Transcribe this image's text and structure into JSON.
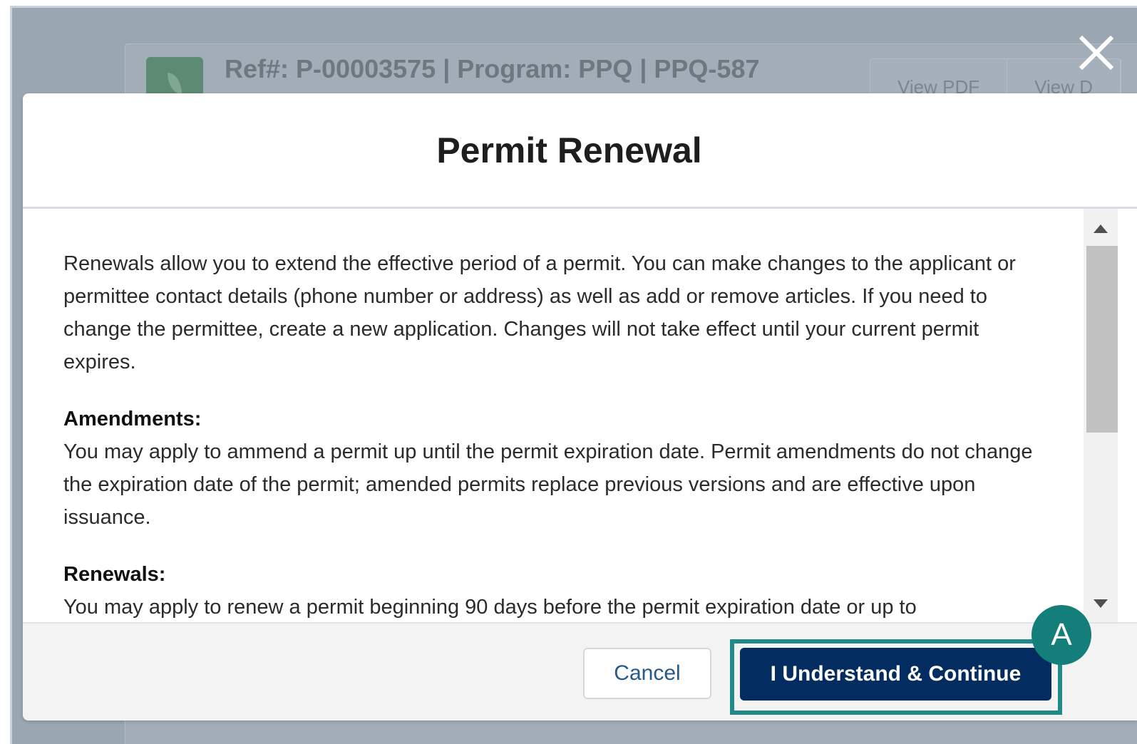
{
  "background": {
    "ref_line": "Ref#: P-00003575 | Program: PPQ | PPQ-587",
    "buttons": [
      "View PDF",
      "View D"
    ]
  },
  "modal": {
    "title": "Permit Renewal",
    "paragraphs": [
      "Renewals allow you to extend the effective period of a permit. You can make changes to the applicant or permittee contact details (phone number or address) as well as add or remove articles. If you need to change the permittee, create a new application. Changes will not take effect until your current permit expires."
    ],
    "sections": [
      {
        "heading": "Amendments:",
        "text": "You may apply to ammend a permit up until the permit expiration date. Permit amendments do not change the expiration date of the permit; amended permits replace previous versions and are effective upon issuance."
      },
      {
        "heading": "Renewals:",
        "text": "You may apply to renew a permit beginning 90 days before the permit expiration date or up to"
      }
    ],
    "footer": {
      "cancel_label": "Cancel",
      "continue_label": "I Understand & Continue"
    }
  },
  "annotation": {
    "marker_label": "A",
    "accent_color": "#1f8a87"
  },
  "icons": {
    "close": "close-icon",
    "scroll_up": "arrow-up-icon",
    "scroll_down": "arrow-down-icon"
  }
}
